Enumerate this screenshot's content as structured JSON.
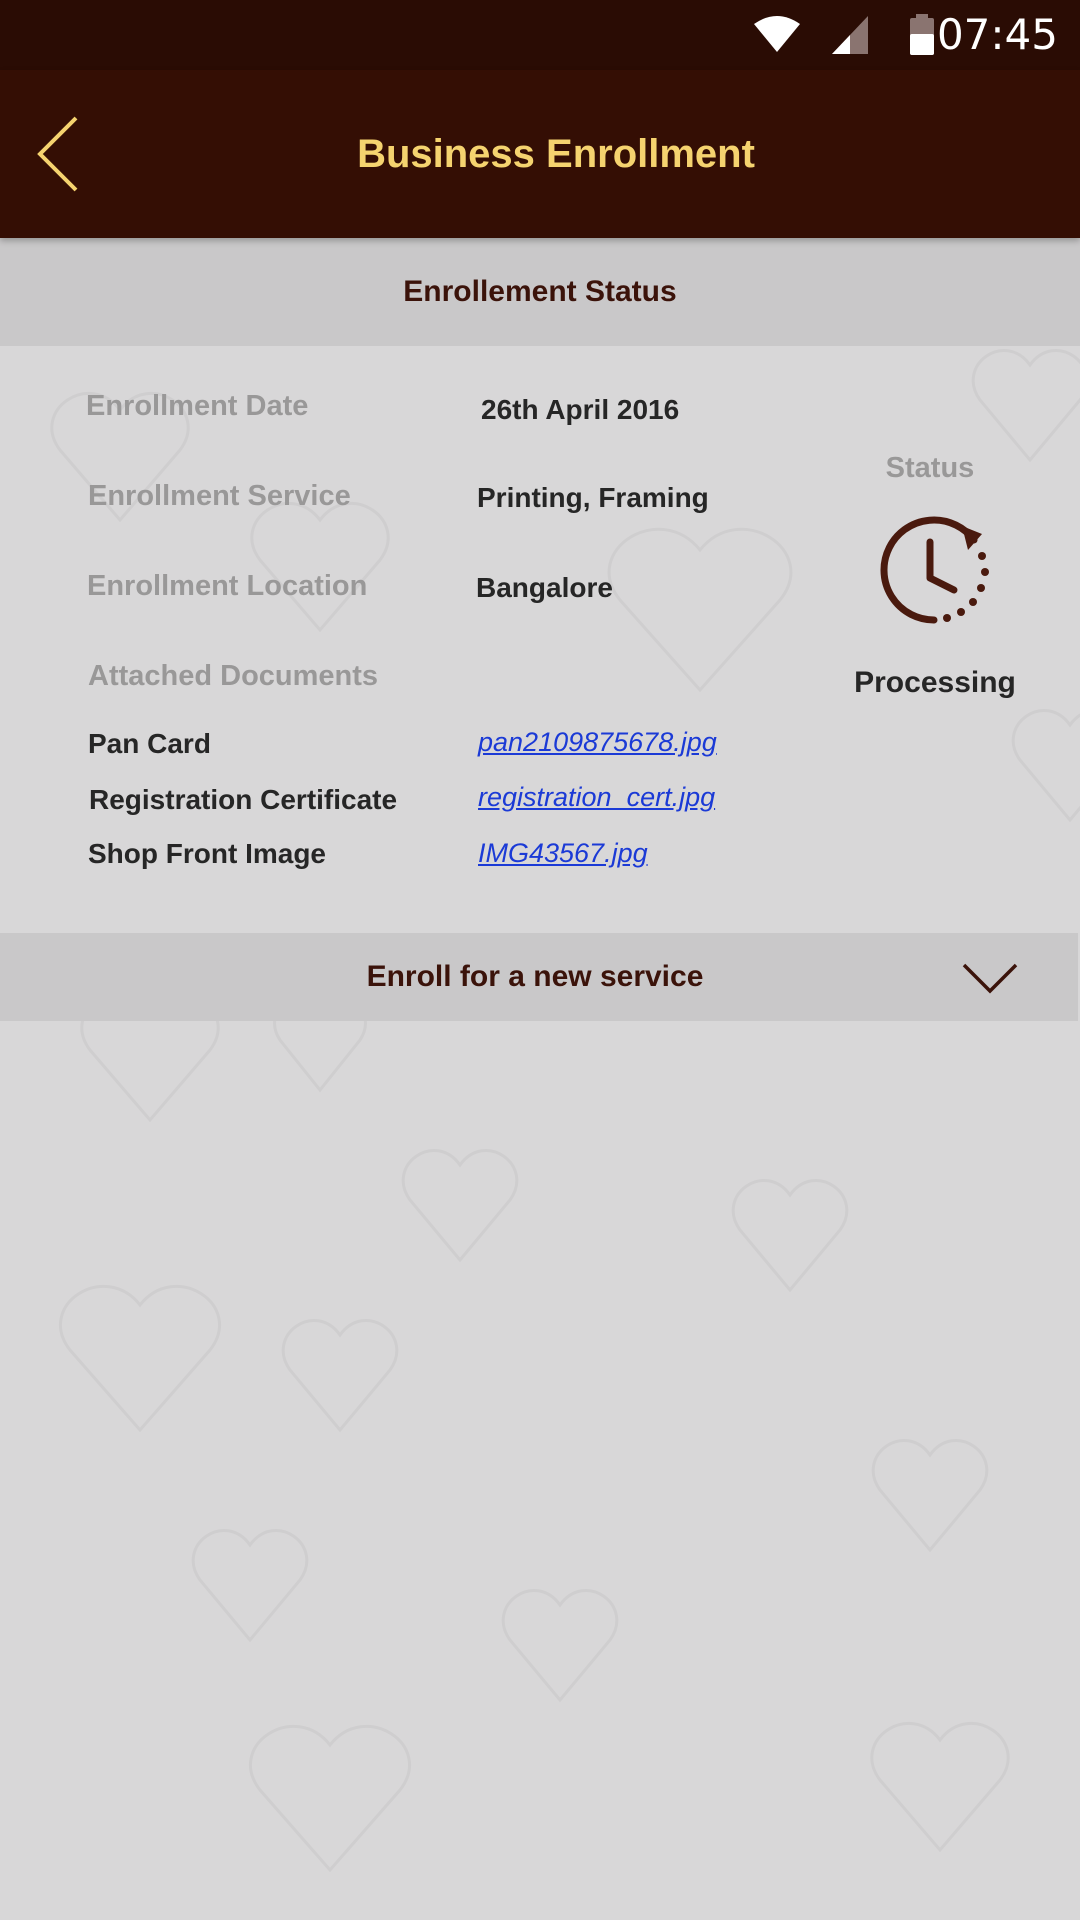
{
  "status_bar": {
    "time": "07:45",
    "icons": [
      "wifi-icon",
      "cellular-signal-icon",
      "battery-icon"
    ]
  },
  "app_bar": {
    "title": "Business Enrollment",
    "back_icon": "chevron-left-icon"
  },
  "section": {
    "title": "Enrollement Status"
  },
  "details": {
    "date_label": "Enrollment Date",
    "date_value": "26th April 2016",
    "service_label": "Enrollment Service",
    "service_value": "Printing, Framing",
    "location_label": "Enrollment Location",
    "location_value": "Bangalore"
  },
  "documents": {
    "label": "Attached Documents",
    "items": [
      {
        "name": "Pan Card",
        "file": "pan2109875678.jpg"
      },
      {
        "name": "Registration Certificate",
        "file": "registration_cert.jpg"
      },
      {
        "name": "Shop Front Image",
        "file": "IMG43567.jpg"
      }
    ]
  },
  "status": {
    "label": "Status",
    "value": "Processing",
    "icon": "clock-history-icon"
  },
  "enroll_new": {
    "label": "Enroll for a new service",
    "icon": "chevron-down-icon"
  },
  "colors": {
    "status_bar": "#2a0c04",
    "app_bar": "#340e04",
    "title_accent": "#f5d36f",
    "section_bg": "#c9c8c9",
    "section_text": "#3b130a",
    "link": "#1b3ad6",
    "page_bg": "#d8d7d8"
  }
}
